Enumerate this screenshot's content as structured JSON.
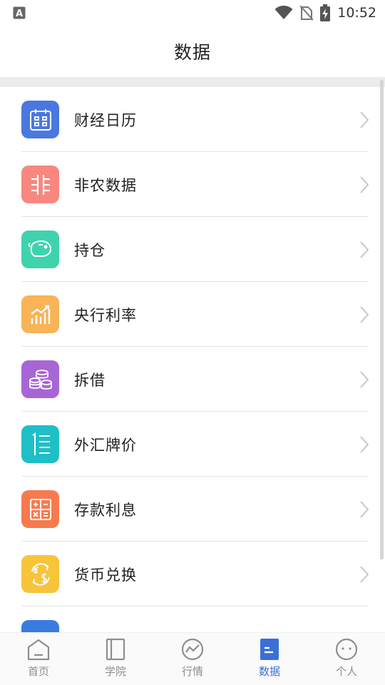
{
  "status": {
    "time": "10:52",
    "app_badge": "A"
  },
  "header": {
    "title": "数据"
  },
  "list": {
    "items": [
      {
        "label": "财经日历",
        "icon": "calendar-icon",
        "color": "#4a78e0"
      },
      {
        "label": "非农数据",
        "icon": "fei-character-icon",
        "color": "#f7877f"
      },
      {
        "label": "持仓",
        "icon": "piggy-bank-icon",
        "color": "#3fd3ad"
      },
      {
        "label": "央行利率",
        "icon": "bar-chart-trend-icon",
        "color": "#f8b457"
      },
      {
        "label": "拆借",
        "icon": "coins-stack-icon",
        "color": "#a766d6"
      },
      {
        "label": "外汇牌价",
        "icon": "rate-list-icon",
        "color": "#1fbfc7"
      },
      {
        "label": "存款利息",
        "icon": "calculator-icon",
        "color": "#f77a4e"
      },
      {
        "label": "货币兑换",
        "icon": "currency-exchange-icon",
        "color": "#f7c43a"
      },
      {
        "label": "",
        "icon": "partial-item-icon",
        "color": "#3a7be0"
      }
    ]
  },
  "tabs": [
    {
      "label": "首页",
      "icon": "home-icon",
      "active": false
    },
    {
      "label": "学院",
      "icon": "book-icon",
      "active": false
    },
    {
      "label": "行情",
      "icon": "market-trend-icon",
      "active": false
    },
    {
      "label": "数据",
      "icon": "data-doc-icon",
      "active": true
    },
    {
      "label": "个人",
      "icon": "profile-face-icon",
      "active": false
    }
  ],
  "colors": {
    "accent": "#3a6fd8",
    "inactive_tab": "#8e8e8e",
    "divider": "#e3e3e3"
  }
}
